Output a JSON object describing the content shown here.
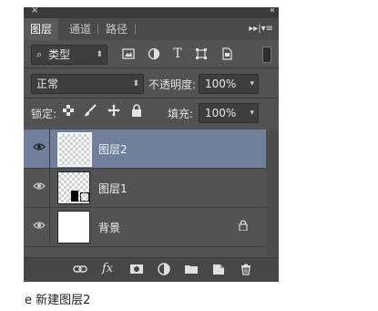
{
  "panel": {
    "close_glyph": "×",
    "collapse_glyph": "«",
    "tabs": [
      {
        "label": "图层",
        "active": true
      },
      {
        "label": "通道",
        "active": false
      },
      {
        "label": "路径",
        "active": false
      }
    ],
    "menu_glyph": "▸▸|▾≡"
  },
  "filter": {
    "kind_label": "类型",
    "icons": [
      "image-filter-icon",
      "adjustment-filter-icon",
      "type-filter-icon",
      "shape-filter-icon",
      "smart-object-filter-icon"
    ]
  },
  "blend": {
    "mode": "正常",
    "opacity_label": "不透明度:",
    "opacity_value": "100%"
  },
  "lock": {
    "label": "锁定:",
    "fill_label": "填充:",
    "fill_value": "100%"
  },
  "layers": [
    {
      "name": "图层2",
      "selected": true,
      "thumb": "transparent"
    },
    {
      "name": "图层1",
      "selected": false,
      "thumb": "transparent-with-shape"
    },
    {
      "name": "背景",
      "selected": false,
      "thumb": "white",
      "locked": true
    }
  ],
  "bottom_bar": {
    "icons": [
      "link-icon",
      "fx-icon",
      "mask-icon",
      "adjustment-layer-icon",
      "group-folder-icon",
      "new-layer-icon",
      "trash-icon"
    ],
    "fx_label": "fx"
  },
  "caption": "e 新建图层2"
}
